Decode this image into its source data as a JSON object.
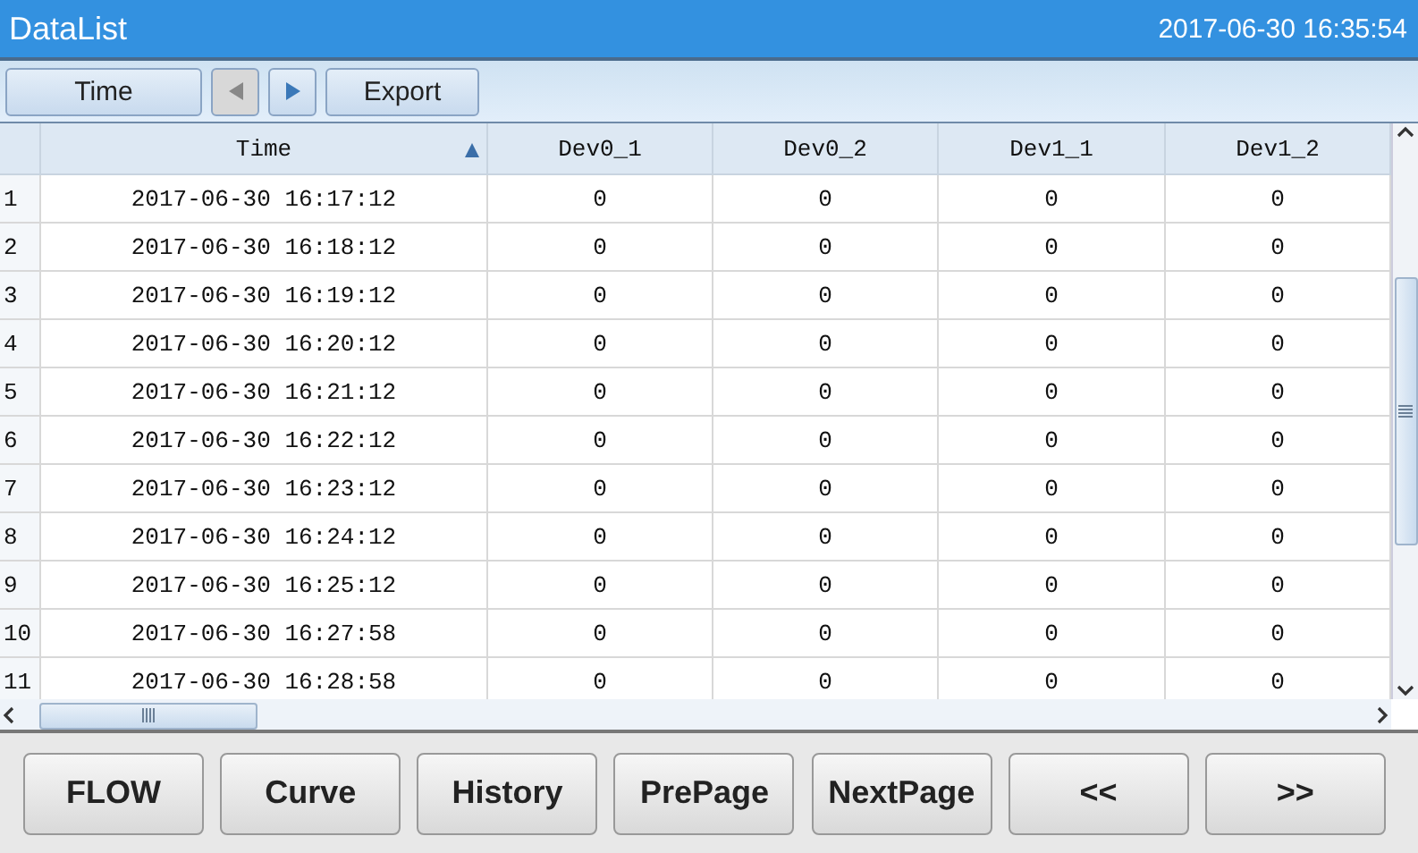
{
  "window": {
    "title": "DataList",
    "clock": "2017-06-30 16:35:54"
  },
  "toolbar": [
    {
      "kind": "text",
      "label": "Time",
      "disabled": false
    },
    {
      "kind": "prev",
      "disabled": true
    },
    {
      "kind": "next",
      "disabled": false
    },
    {
      "kind": "text",
      "label": "Export",
      "disabled": false
    }
  ],
  "table": {
    "columns": [
      {
        "label": "Time",
        "sorted": true
      },
      {
        "label": "Dev0_1"
      },
      {
        "label": "Dev0_2"
      },
      {
        "label": "Dev1_1"
      },
      {
        "label": "Dev1_2"
      }
    ],
    "rows": [
      {
        "index": "1",
        "cells": [
          "2017-06-30 16:17:12",
          "0",
          "0",
          "0",
          "0"
        ]
      },
      {
        "index": "2",
        "cells": [
          "2017-06-30 16:18:12",
          "0",
          "0",
          "0",
          "0"
        ]
      },
      {
        "index": "3",
        "cells": [
          "2017-06-30 16:19:12",
          "0",
          "0",
          "0",
          "0"
        ]
      },
      {
        "index": "4",
        "cells": [
          "2017-06-30 16:20:12",
          "0",
          "0",
          "0",
          "0"
        ]
      },
      {
        "index": "5",
        "cells": [
          "2017-06-30 16:21:12",
          "0",
          "0",
          "0",
          "0"
        ]
      },
      {
        "index": "6",
        "cells": [
          "2017-06-30 16:22:12",
          "0",
          "0",
          "0",
          "0"
        ]
      },
      {
        "index": "7",
        "cells": [
          "2017-06-30 16:23:12",
          "0",
          "0",
          "0",
          "0"
        ]
      },
      {
        "index": "8",
        "cells": [
          "2017-06-30 16:24:12",
          "0",
          "0",
          "0",
          "0"
        ]
      },
      {
        "index": "9",
        "cells": [
          "2017-06-30 16:25:12",
          "0",
          "0",
          "0",
          "0"
        ]
      },
      {
        "index": "10",
        "cells": [
          "2017-06-30 16:27:58",
          "0",
          "0",
          "0",
          "0"
        ]
      },
      {
        "index": "11",
        "cells": [
          "2017-06-30 16:28:58",
          "0",
          "0",
          "0",
          "0"
        ]
      }
    ]
  },
  "buttons": [
    "FLOW",
    "Curve",
    "History",
    "PrePage",
    "NextPage",
    "<<",
    ">>"
  ]
}
